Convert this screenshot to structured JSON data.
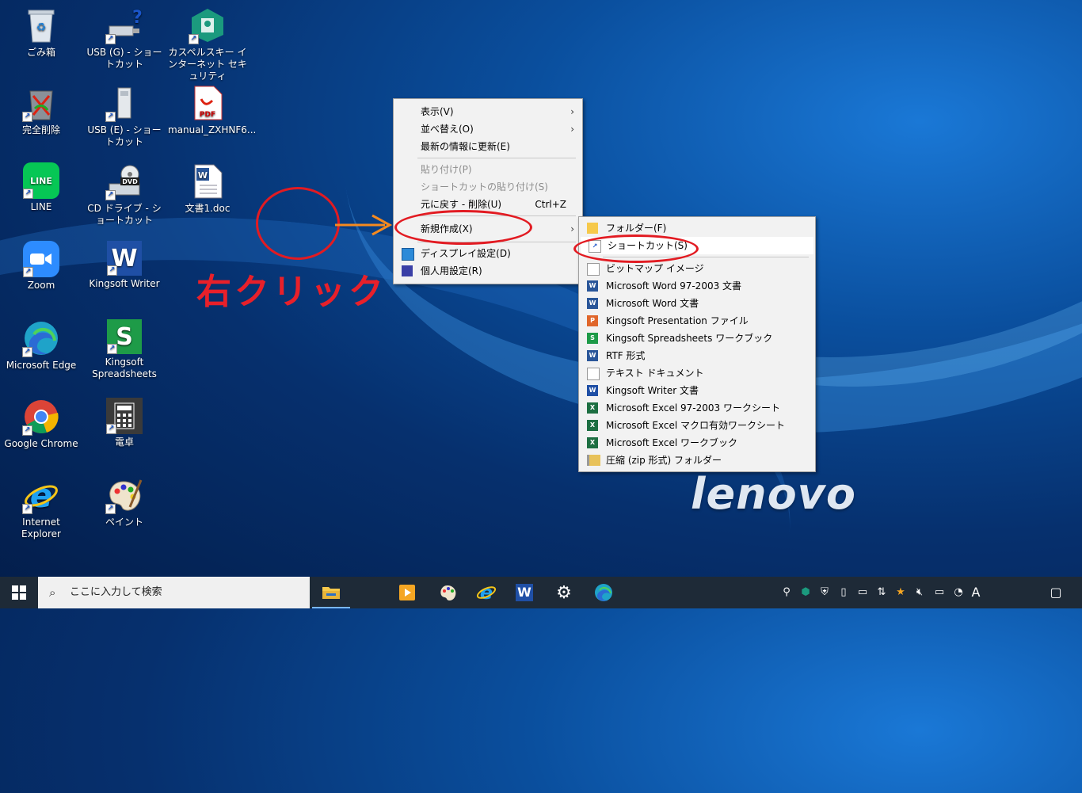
{
  "desktop": {
    "icons": [
      {
        "label": "ごみ箱"
      },
      {
        "label": "USB (G) - ショートカット"
      },
      {
        "label": "カスペルスキー インターネット セキュリティ"
      },
      {
        "label": "完全削除"
      },
      {
        "label": "USB (E) - ショートカット"
      },
      {
        "label": "manual_ZXHNF6..."
      },
      {
        "label": "LINE"
      },
      {
        "label": "CD ドライブ - ショートカット"
      },
      {
        "label": "文書1.doc"
      },
      {
        "label": "Zoom"
      },
      {
        "label": "Kingsoft Writer"
      },
      {
        "label": "Microsoft Edge"
      },
      {
        "label": "Kingsoft Spreadsheets"
      },
      {
        "label": "Google Chrome"
      },
      {
        "label": "電卓"
      },
      {
        "label": "Internet Explorer"
      },
      {
        "label": "ペイント"
      }
    ],
    "brand_logo": "lenovo"
  },
  "annotation": {
    "text": "右クリック",
    "color": "#e8202a"
  },
  "context_menu": {
    "items": [
      {
        "label": "表示(V)"
      },
      {
        "label": "並べ替え(O)"
      },
      {
        "label": "最新の情報に更新(E)"
      },
      {
        "label": "貼り付け(P)"
      },
      {
        "label": "ショートカットの貼り付け(S)"
      },
      {
        "label": "元に戻す - 削除(U)",
        "shortcut": "Ctrl+Z"
      },
      {
        "label": "新規作成(X)"
      },
      {
        "label": "ディスプレイ設定(D)"
      },
      {
        "label": "個人用設定(R)"
      }
    ]
  },
  "submenu": {
    "items": [
      {
        "label": "フォルダー(F)"
      },
      {
        "label": "ショートカット(S)"
      },
      {
        "label": "ビットマップ イメージ"
      },
      {
        "label": "Microsoft Word 97-2003 文書"
      },
      {
        "label": "Microsoft Word 文書"
      },
      {
        "label": "Kingsoft Presentation ファイル"
      },
      {
        "label": "Kingsoft Spreadsheets ワークブック"
      },
      {
        "label": "RTF 形式"
      },
      {
        "label": "テキスト ドキュメント"
      },
      {
        "label": "Kingsoft Writer 文書"
      },
      {
        "label": "Microsoft Excel 97-2003 ワークシート"
      },
      {
        "label": "Microsoft Excel マクロ有効ワークシート"
      },
      {
        "label": "Microsoft Excel ワークブック"
      },
      {
        "label": "圧縮 (zip 形式) フォルダー"
      }
    ]
  },
  "taskbar": {
    "search_placeholder": "ここに入力して検索",
    "ime_indicator": "A"
  },
  "colors": {
    "accent": "#0078d7",
    "taskbar": "#1e2a37",
    "menu_bg": "#f2f2f2",
    "highlight_ring": "#e21b22",
    "arrow": "#f58a1f"
  }
}
